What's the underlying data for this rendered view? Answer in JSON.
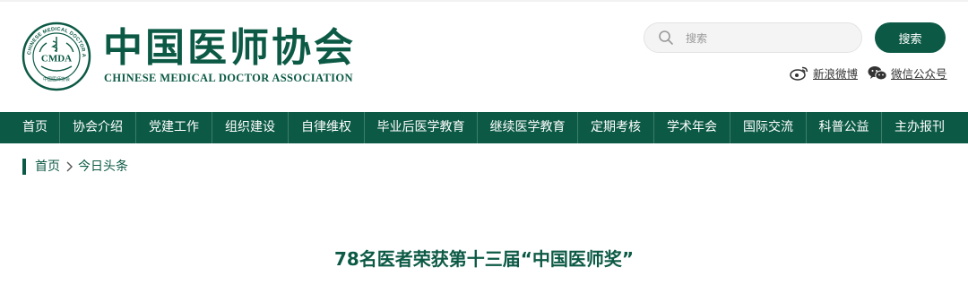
{
  "header": {
    "logo_cn": "中国医师协会",
    "logo_en": "CHINESE MEDICAL DOCTOR ASSOCIATION",
    "badge": {
      "abbr": "CMDA",
      "ring_text": "CHINESE MEDICAL DOCTOR ASSOCIATION",
      "bottom_text": "中国医师协会"
    },
    "search": {
      "placeholder": "搜索",
      "value": ""
    },
    "search_button": "搜索",
    "social": {
      "weibo": "新浪微博",
      "wechat": "微信公众号"
    }
  },
  "nav": {
    "items": [
      "首页",
      "协会介绍",
      "党建工作",
      "组织建设",
      "自律维权",
      "毕业后医学教育",
      "继续医学教育",
      "定期考核",
      "学术年会",
      "国际交流",
      "科普公益",
      "主办报刊"
    ]
  },
  "breadcrumb": {
    "home": "首页",
    "current": "今日头条"
  },
  "article": {
    "title": "78名医者荣获第十三届“中国医师奖”"
  },
  "colors": {
    "brand": "#0c5a45",
    "nav_bg": "#0c5a45",
    "separator": "#3d7d6b"
  }
}
